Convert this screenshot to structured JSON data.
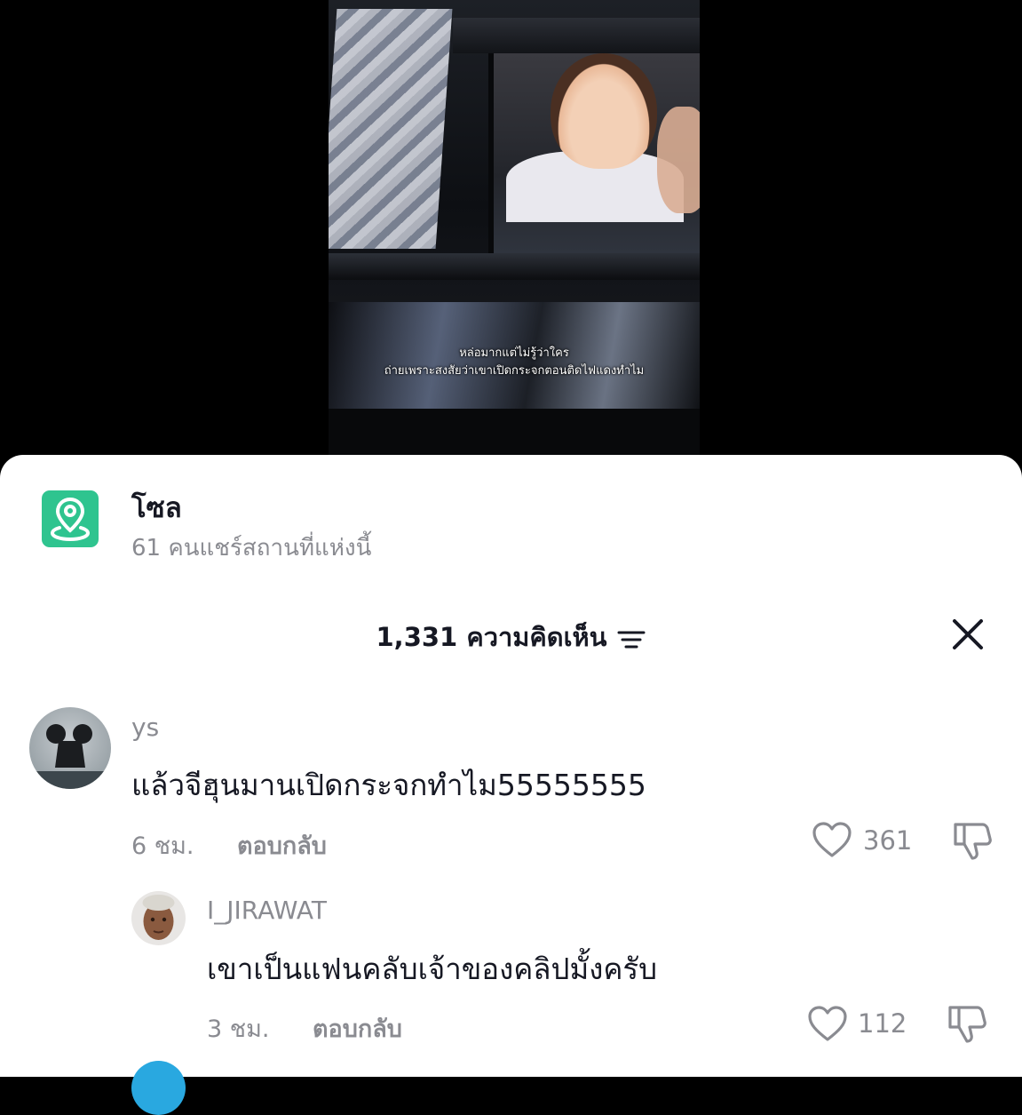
{
  "video": {
    "caption_line1": "หล่อมากแต่ไม่รู้ว่าใคร",
    "caption_line2": "ถ่ายเพราะสงสัยว่าเขาเปิดกระจกตอนติดไฟแดงทำไม"
  },
  "location": {
    "icon": "location-pin-icon",
    "name": "โซล",
    "subtitle": "61 คนแชร์สถานที่แห่งนี้",
    "accent_color": "#2fc48f"
  },
  "comments_header": {
    "title": "1,331 ความคิดเห็น",
    "sort_icon": "sort-icon",
    "close_icon": "close-icon"
  },
  "comments": [
    {
      "username": "ys",
      "text": "แล้วจีฮุนมานเปิดกระจกทำไม55555555",
      "time": "6 ชม.",
      "reply_label": "ตอบกลับ",
      "likes": "361"
    },
    {
      "username": "I_JIRAWAT",
      "text": "เขาเป็นแฟนคลับเจ้าของคลิปมั้งครับ",
      "time": "3 ชม.",
      "reply_label": "ตอบกลับ",
      "likes": "112"
    }
  ],
  "colors": {
    "text_primary": "#161823",
    "text_secondary": "#8a8b91",
    "next_avatar": "#29a8e0"
  }
}
